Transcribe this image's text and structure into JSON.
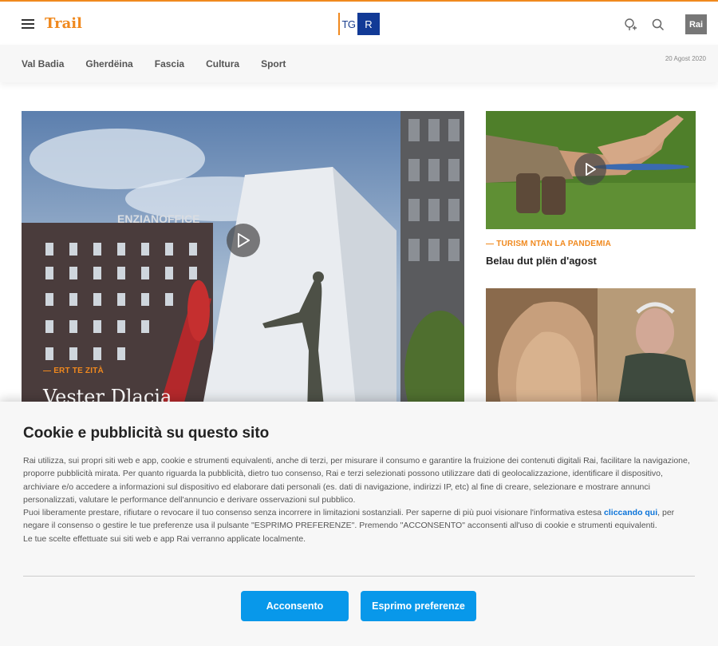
{
  "header": {
    "brand": "Trail",
    "logo_text": "TG",
    "logo_box": "R",
    "rai_logo": "Rai"
  },
  "nav": {
    "items": [
      {
        "label": "Val Badia"
      },
      {
        "label": "Gherdëina"
      },
      {
        "label": "Fascia"
      },
      {
        "label": "Cultura"
      },
      {
        "label": "Sport"
      }
    ],
    "date": "20 Agost 2020"
  },
  "hero": {
    "kicker": "ERT TE ZITÀ",
    "title": "Vester Dlacia",
    "sign_text": "ENZIANOFFICE"
  },
  "side_articles": [
    {
      "kicker": "TURISM NTAN LA PANDEMIA",
      "title": "Belau dut plën d'agost"
    }
  ],
  "cookie": {
    "title": "Cookie e pubblicità su questo sito",
    "p1": "Rai utilizza, sui propri siti web e app, cookie e strumenti equivalenti, anche di terzi, per misurare il consumo e garantire la fruizione dei contenuti digitali Rai, facilitare la navigazione, proporre pubblicità mirata. Per quanto riguarda la pubblicità, dietro tuo consenso, Rai e terzi selezionati possono utilizzare dati di geolocalizzazione, identificare il dispositivo, archiviare e/o accedere a informazioni sul dispositivo ed elaborare dati personali (es. dati di navigazione, indirizzi IP, etc) al fine di creare, selezionare e mostrare annunci personalizzati, valutare le performance dell'annuncio e derivare osservazioni sul pubblico.",
    "p2_before": "Puoi liberamente prestare, rifiutare o revocare il tuo consenso senza incorrere in limitazioni sostanziali. Per saperne di più puoi visionare l'informativa estesa ",
    "p2_link": "cliccando qui",
    "p2_after": ", per negare il consenso o gestire le tue preferenze usa il pulsante \"ESPRIMO PREFERENZE\". Premendo \"ACCONSENTO\" acconsenti all'uso di cookie e strumenti equivalenti.",
    "p3": "Le tue scelte effettuate sui siti web e app Rai verranno applicate localmente.",
    "accept_label": "Acconsento",
    "prefs_label": "Esprimo preferenze"
  },
  "colors": {
    "accent": "#f0891e",
    "button": "#0898ea",
    "link": "#0a73d9"
  }
}
